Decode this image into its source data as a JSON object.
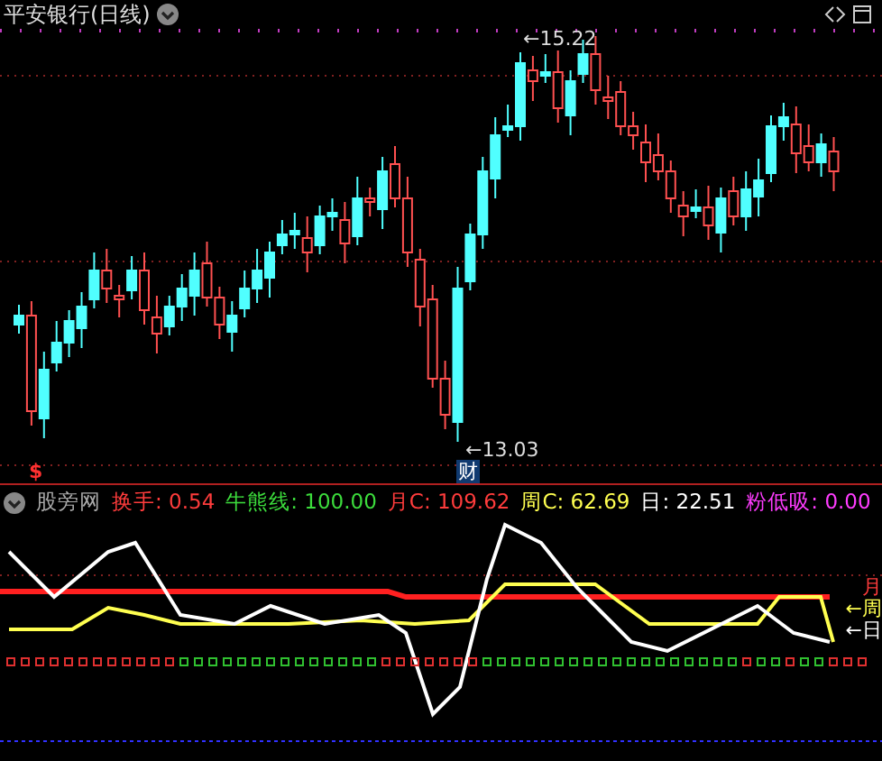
{
  "chart": {
    "title": "平安银行(日线)",
    "high_label": "←15.22",
    "low_label": "←13.03",
    "event_badge": "财",
    "marker": "$"
  },
  "indicator": {
    "name": "股旁网",
    "readings": [
      {
        "label": "换手:",
        "value": "0.54",
        "color": "#ff3c3c"
      },
      {
        "label": "牛熊线:",
        "value": "100.00",
        "color": "#3cdc3c"
      },
      {
        "label": "月C:",
        "value": "109.62",
        "color": "#ff3c3c"
      },
      {
        "label": "周C:",
        "value": "62.69",
        "color": "#ffff50"
      },
      {
        "label": "日:",
        "value": "22.51",
        "color": "#ffffff"
      },
      {
        "label": "粉低吸:",
        "value": "0.00",
        "color": "#ff3cff"
      }
    ],
    "line_labels": [
      {
        "text": "月",
        "color": "#ff3c3c"
      },
      {
        "text": "←周",
        "color": "#ffff50"
      },
      {
        "text": "←日",
        "color": "#ffffff"
      }
    ]
  }
}
